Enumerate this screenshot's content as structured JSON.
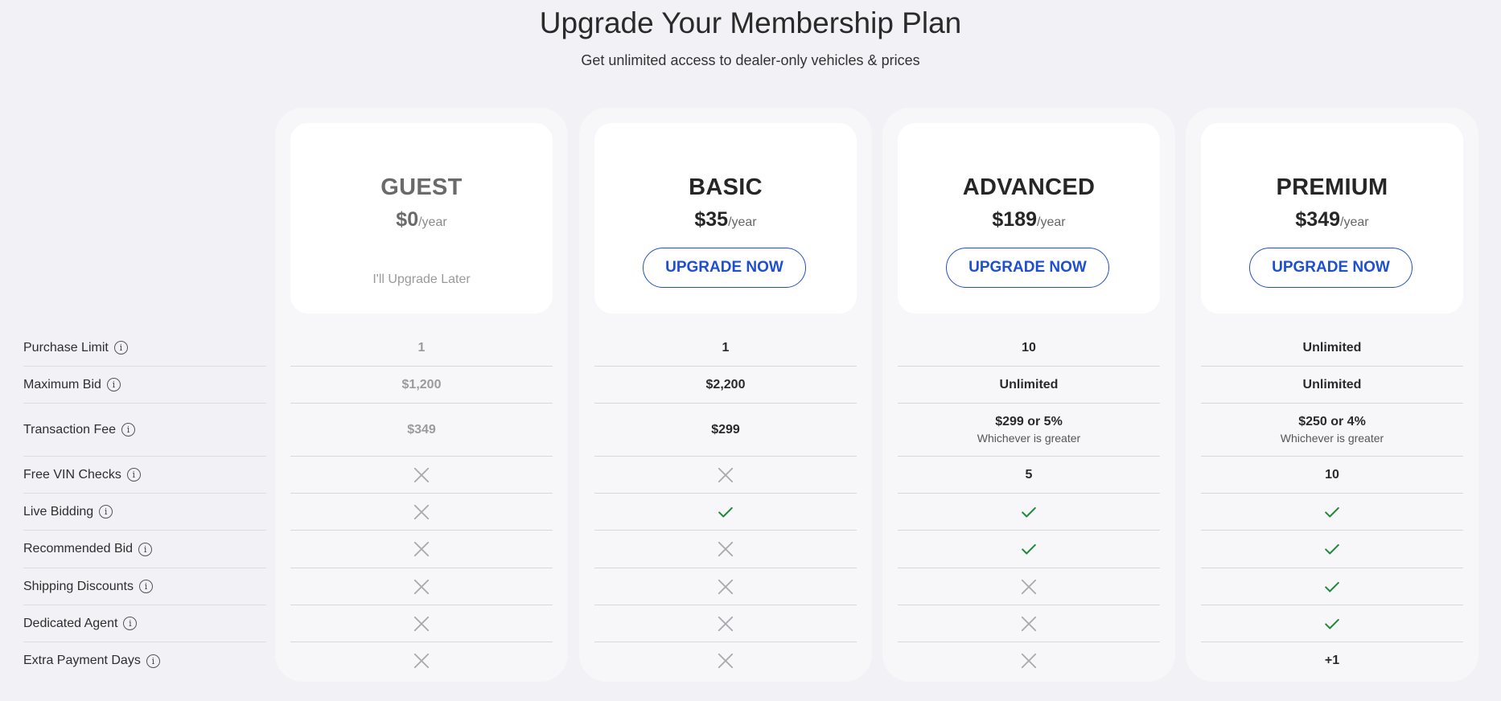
{
  "header": {
    "title": "Upgrade Your Membership Plan",
    "subtitle": "Get unlimited access to dealer-only vehicles & prices"
  },
  "features": [
    {
      "label": "Purchase Limit"
    },
    {
      "label": "Maximum Bid"
    },
    {
      "label": "Transaction Fee"
    },
    {
      "label": "Free VIN Checks"
    },
    {
      "label": "Live Bidding"
    },
    {
      "label": "Recommended Bid"
    },
    {
      "label": "Shipping Discounts"
    },
    {
      "label": "Dedicated Agent"
    },
    {
      "label": "Extra Payment Days"
    }
  ],
  "info_icon_glyph": "i",
  "colors": {
    "accent": "#1f4fd1",
    "check": "#1f8a3a",
    "cross": "#a8a8ad"
  },
  "plans": [
    {
      "name": "GUEST",
      "price": "$0",
      "period": "/year",
      "action": "I'll Upgrade Later",
      "values": [
        {
          "text": "1"
        },
        {
          "text": "$1,200"
        },
        {
          "text": "$349"
        },
        {
          "icon": "cross"
        },
        {
          "icon": "cross"
        },
        {
          "icon": "cross"
        },
        {
          "icon": "cross"
        },
        {
          "icon": "cross"
        },
        {
          "icon": "cross"
        }
      ]
    },
    {
      "name": "BASIC",
      "price": "$35",
      "period": "/year",
      "action": "UPGRADE NOW",
      "values": [
        {
          "text": "1"
        },
        {
          "text": "$2,200"
        },
        {
          "text": "$299"
        },
        {
          "icon": "cross"
        },
        {
          "icon": "check"
        },
        {
          "icon": "cross"
        },
        {
          "icon": "cross"
        },
        {
          "icon": "cross"
        },
        {
          "icon": "cross"
        }
      ]
    },
    {
      "name": "ADVANCED",
      "price": "$189",
      "period": "/year",
      "action": "UPGRADE NOW",
      "values": [
        {
          "text": "10"
        },
        {
          "text": "Unlimited"
        },
        {
          "text": "$299 or 5%",
          "sub": "Whichever is greater"
        },
        {
          "text": "5"
        },
        {
          "icon": "check"
        },
        {
          "icon": "check"
        },
        {
          "icon": "cross"
        },
        {
          "icon": "cross"
        },
        {
          "icon": "cross"
        }
      ]
    },
    {
      "name": "PREMIUM",
      "price": "$349",
      "period": "/year",
      "action": "UPGRADE NOW",
      "values": [
        {
          "text": "Unlimited"
        },
        {
          "text": "Unlimited"
        },
        {
          "text": "$250 or 4%",
          "sub": "Whichever is greater"
        },
        {
          "text": "10"
        },
        {
          "icon": "check"
        },
        {
          "icon": "check"
        },
        {
          "icon": "check"
        },
        {
          "icon": "check"
        },
        {
          "text": "+1"
        }
      ]
    }
  ]
}
